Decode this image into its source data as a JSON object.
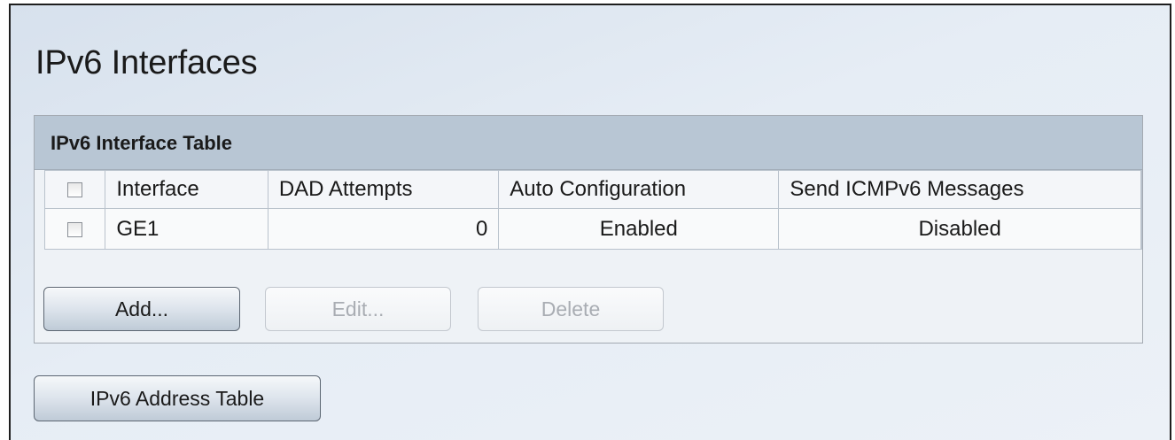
{
  "page": {
    "title": "IPv6 Interfaces"
  },
  "table": {
    "caption": "IPv6 Interface Table",
    "columns": [
      "Interface",
      "DAD Attempts",
      "Auto Configuration",
      "Send ICMPv6 Messages"
    ],
    "rows": [
      {
        "interface": "GE1",
        "dad_attempts": "0",
        "auto_configuration": "Enabled",
        "send_icmpv6_messages": "Disabled",
        "selected": false
      }
    ],
    "select_all_checked": false
  },
  "buttons": {
    "add": "Add...",
    "edit": "Edit...",
    "delete": "Delete",
    "address_table": "IPv6 Address Table"
  },
  "colors": {
    "caption_bar": "#b8c6d4",
    "background": "#e6edf5"
  }
}
